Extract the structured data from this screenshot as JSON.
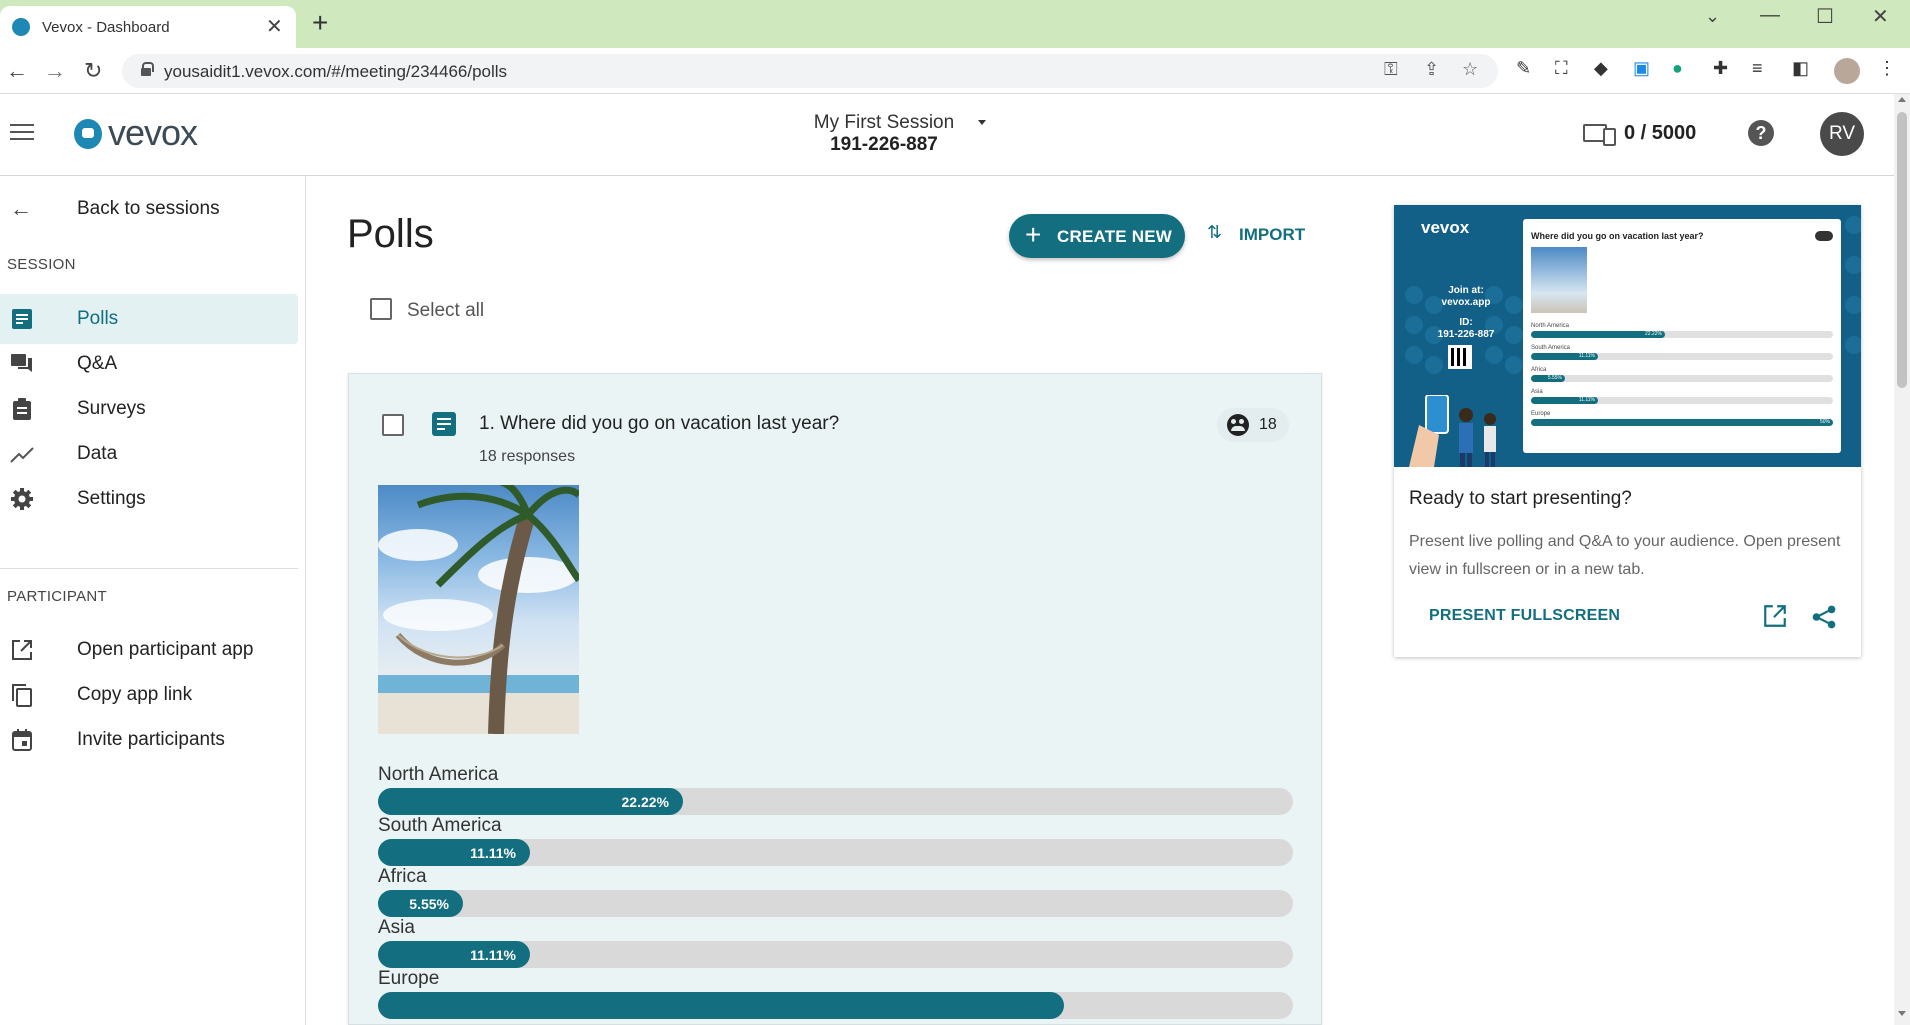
{
  "browser": {
    "tab_title": "Vevox - Dashboard",
    "tab_close": "✕",
    "new_tab": "+",
    "url": "yousaidit1.vevox.com/#/meeting/234466/polls",
    "back": "←",
    "forward": "→",
    "reload": "↻",
    "minimize": "—",
    "maximize": "☐",
    "close": "✕",
    "chevron": "⌄"
  },
  "header": {
    "logo": "vevox",
    "session_name": "My First Session",
    "session_id": "191-226-887",
    "participant_count": "0 / 5000",
    "help": "?",
    "avatar_initials": "RV"
  },
  "sidebar": {
    "back_label": "Back to sessions",
    "session_section": "SESSION",
    "session_items": [
      {
        "label": "Polls",
        "icon": "polls-icon",
        "active": true
      },
      {
        "label": "Q&A",
        "icon": "qa-icon",
        "active": false
      },
      {
        "label": "Surveys",
        "icon": "surveys-icon",
        "active": false
      },
      {
        "label": "Data",
        "icon": "data-icon",
        "active": false
      },
      {
        "label": "Settings",
        "icon": "gear-icon",
        "active": false
      }
    ],
    "participant_section": "PARTICIPANT",
    "participant_items": [
      {
        "label": "Open participant app",
        "icon": "open-external-icon"
      },
      {
        "label": "Copy app link",
        "icon": "copy-icon"
      },
      {
        "label": "Invite participants",
        "icon": "calendar-icon"
      }
    ]
  },
  "main": {
    "title": "Polls",
    "create_label": "CREATE NEW",
    "import_label": "IMPORT",
    "select_all_label": "Select all",
    "poll": {
      "question": "1. Where did you go on vacation last year?",
      "responses": "18 responses",
      "participants": "18",
      "options": [
        {
          "label": "North America",
          "percent": 22.22,
          "value_label": "22.22%"
        },
        {
          "label": "South America",
          "percent": 11.11,
          "value_label": "11.11%"
        },
        {
          "label": "Africa",
          "percent": 5.55,
          "value_label": "5.55%"
        },
        {
          "label": "Asia",
          "percent": 11.11,
          "value_label": "11.11%"
        },
        {
          "label": "Europe",
          "percent": 50,
          "value_label": ""
        }
      ]
    }
  },
  "present": {
    "preview": {
      "logo": "vevox",
      "join_line1": "Join at:",
      "join_line2": "vevox.app",
      "id_label": "ID:",
      "id_value": "191-226-887",
      "question": "Where did you go on vacation last year?",
      "rows": [
        {
          "label": "North America",
          "percent": 22.22,
          "value_label": "22.22%"
        },
        {
          "label": "South America",
          "percent": 11.11,
          "value_label": "11.11%"
        },
        {
          "label": "Africa",
          "percent": 5.55,
          "value_label": "5.55%"
        },
        {
          "label": "Asia",
          "percent": 11.11,
          "value_label": "11.11%"
        },
        {
          "label": "Europe",
          "percent": 50,
          "value_label": "50%"
        }
      ]
    },
    "title": "Ready to start presenting?",
    "description": "Present live polling and Q&A to your audience. Open present view in fullscreen or in a new tab.",
    "fullscreen_label": "PRESENT FULLSCREEN"
  },
  "colors": {
    "accent": "#136f7f",
    "active_bg": "#e3f1f3",
    "card_bg": "#eaf4f5",
    "browser_frame": "#cfe8bd"
  }
}
